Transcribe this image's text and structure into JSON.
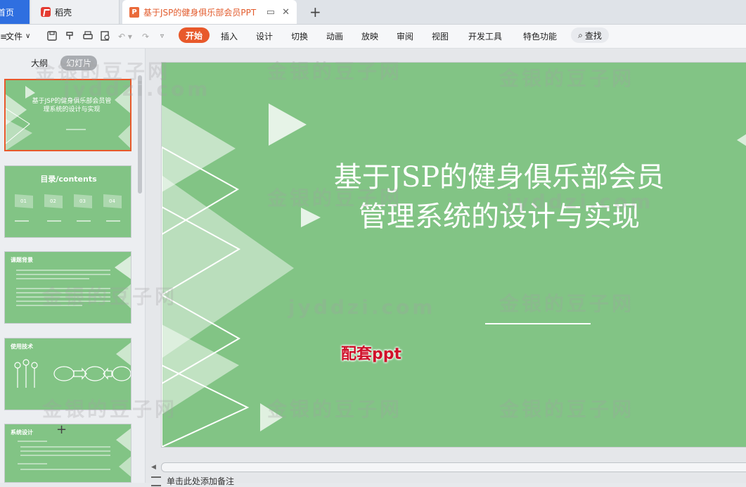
{
  "tabs": {
    "home": "首页",
    "daoke": "稻壳",
    "document": "基于JSP的健身俱乐部会员PPT"
  },
  "menu": {
    "file": "文件",
    "items": [
      "开始",
      "插入",
      "设计",
      "切换",
      "动画",
      "放映",
      "审阅",
      "视图",
      "开发工具",
      "特色功能"
    ],
    "search": "查找"
  },
  "left_pane": {
    "outline_tab": "大纲",
    "slides_tab": "幻灯片",
    "thumbs": {
      "t1_title": "基于JSP的健身俱乐部会员管理系统的设计与实现",
      "t2_title": "目录/contents",
      "t2_nums": [
        "01",
        "02",
        "03",
        "04"
      ],
      "t3_title": "课题背景",
      "t4_title": "使用技术",
      "t5_title": "系统设计"
    }
  },
  "slide": {
    "title_line1": "基于JSP的健身俱乐部会员",
    "title_line2": "管理系统的设计与实现",
    "stamp": "配套ppt"
  },
  "notes_placeholder": "单击此处添加备注",
  "watermark": {
    "cn": "金银的豆子网",
    "url": "jyddzi.com"
  },
  "colors": {
    "slide_green": "#82c485",
    "accent_orange": "#e8592b",
    "home_blue": "#2f6fe0"
  }
}
